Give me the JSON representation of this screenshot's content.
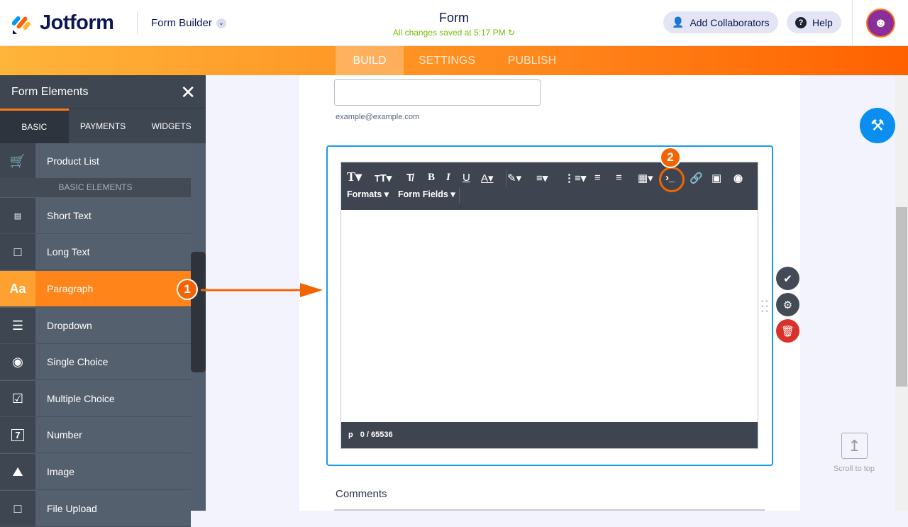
{
  "header": {
    "brand": "Jotform",
    "product": "Form Builder",
    "title": "Form",
    "saved_status": "All changes saved at 5:17 PM",
    "collaborators_label": "Add Collaborators",
    "help_label": "Help"
  },
  "nav": {
    "tabs": [
      {
        "label": "BUILD",
        "active": true
      },
      {
        "label": "SETTINGS"
      },
      {
        "label": "PUBLISH"
      }
    ]
  },
  "sidebar": {
    "title": "Form Elements",
    "tabs": [
      "BASIC",
      "PAYMENTS",
      "WIDGETS"
    ],
    "section_label": "BASIC ELEMENTS",
    "items": [
      {
        "label": "Product List",
        "icon": "cart-icon"
      },
      {
        "label": "Short Text",
        "icon": "short-text-icon"
      },
      {
        "label": "Long Text",
        "icon": "long-text-icon"
      },
      {
        "label": "Paragraph",
        "icon": "paragraph-icon",
        "icon_text": "Aa"
      },
      {
        "label": "Dropdown",
        "icon": "dropdown-icon"
      },
      {
        "label": "Single Choice",
        "icon": "radio-icon"
      },
      {
        "label": "Multiple Choice",
        "icon": "checkbox-icon"
      },
      {
        "label": "Number",
        "icon": "number-icon",
        "icon_text": "7"
      },
      {
        "label": "Image",
        "icon": "image-icon"
      },
      {
        "label": "File Upload",
        "icon": "upload-icon"
      }
    ]
  },
  "form": {
    "email_hint": "example@example.com",
    "comments_label": "Comments"
  },
  "editor": {
    "formats_label": "Formats",
    "form_fields_label": "Form Fields",
    "status_tag": "p",
    "char_count": "0 / 65536"
  },
  "annotations": {
    "step1": "1",
    "step2": "2"
  },
  "scroll_to_top_label": "Scroll to top",
  "colors": {
    "accent": "#ff7a1a",
    "selection": "#1a9be6",
    "brand_navy": "#0a1551"
  }
}
